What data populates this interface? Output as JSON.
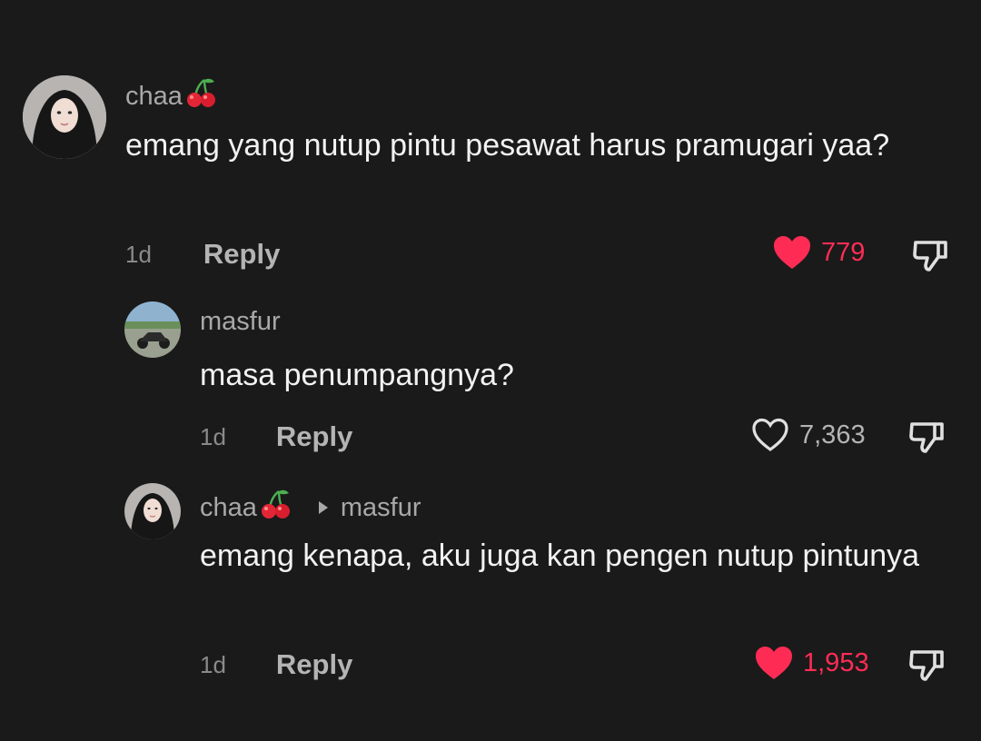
{
  "colors": {
    "background": "#1a1a1a",
    "liked": "#fe2c55",
    "muted": "#a8a8a8"
  },
  "comments": [
    {
      "username": "chaa",
      "username_emoji": "cherries",
      "text": "emang yang nutup pintu pesawat harus pramugari yaa?",
      "time": "1d",
      "reply_label": "Reply",
      "likes": "779",
      "liked": true
    },
    {
      "username": "masfur",
      "text": "masa penumpangnya?",
      "time": "1d",
      "reply_label": "Reply",
      "likes": "7,363",
      "liked": false
    },
    {
      "username": "chaa",
      "username_emoji": "cherries",
      "replying_to": "masfur",
      "text": "emang kenapa, aku juga kan pengen nutup pintunya",
      "time": "1d",
      "reply_label": "Reply",
      "likes": "1,953",
      "liked": true
    }
  ]
}
